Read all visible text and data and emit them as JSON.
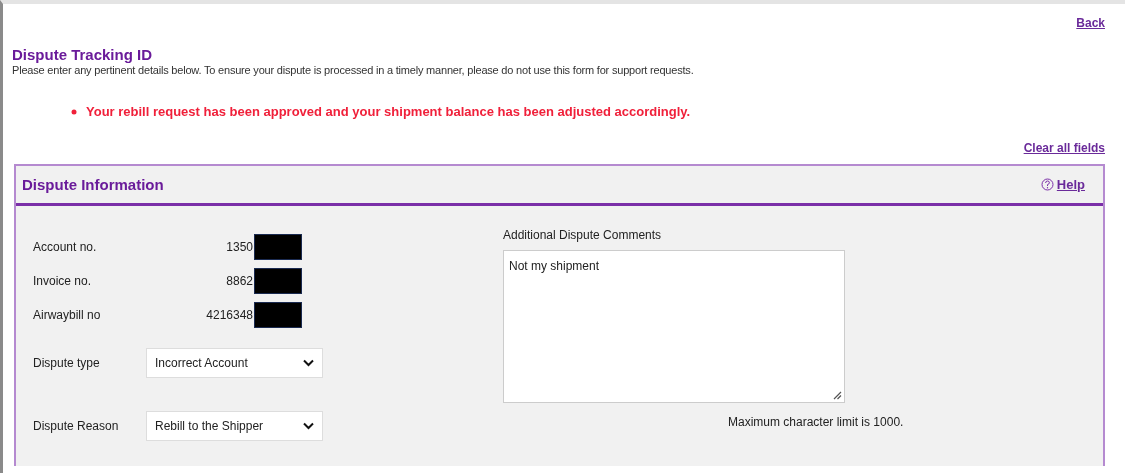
{
  "back_link": "Back",
  "title": "Dispute Tracking ID",
  "instructions": "Please enter any pertinent details below. To ensure your dispute is processed in a timely manner, please do not use this form for support requests.",
  "messages": [
    "Your rebill request has been approved and your shipment balance has been adjusted accordingly."
  ],
  "clear_link": "Clear all fields",
  "panel": {
    "title": "Dispute Information",
    "help_link": "Help",
    "info_rows": [
      {
        "label": "Account no.",
        "value": "1350"
      },
      {
        "label": "Invoice no.",
        "value": "8862"
      },
      {
        "label": "Airwaybill no",
        "value": "4216348"
      }
    ],
    "selects": [
      {
        "label": "Dispute type",
        "value": "Incorrect Account"
      },
      {
        "label": "Dispute Reason",
        "value": "Rebill to the Shipper"
      }
    ],
    "comments": {
      "label": "Additional Dispute Comments",
      "value": "Not my shipment",
      "limit_note": "Maximum character limit is 1000."
    }
  }
}
